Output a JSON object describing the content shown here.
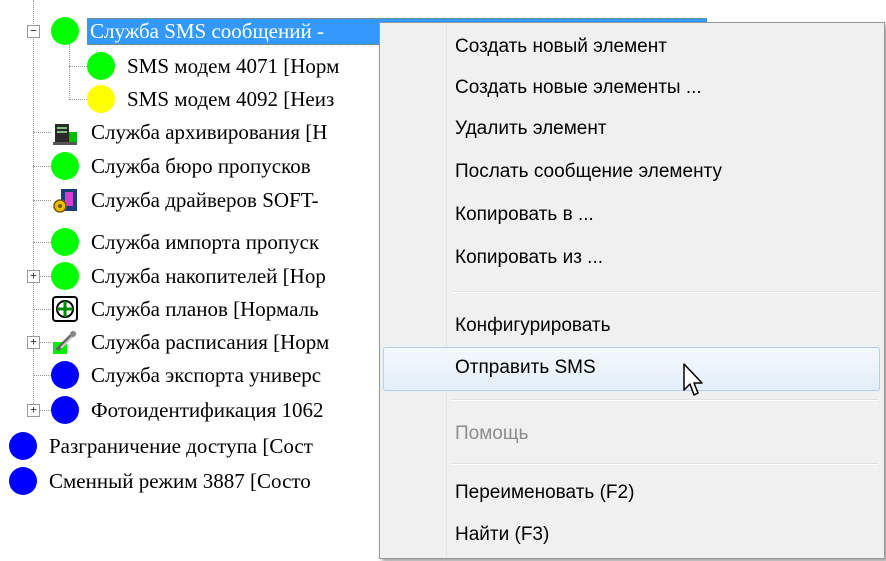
{
  "tree": {
    "items": [
      {
        "label": "Служба SMS сообщений -",
        "icon": "green-circle-icon",
        "selected": true
      },
      {
        "label": "SMS модем 4071 [Норм",
        "icon": "green-circle-icon"
      },
      {
        "label": "SMS модем 4092 [Неиз",
        "icon": "yellow-circle-icon"
      },
      {
        "label": "Служба архивирования [Н",
        "icon": "archive-service-icon"
      },
      {
        "label": "Служба бюро пропусков",
        "icon": "green-circle-icon"
      },
      {
        "label": "Служба драйверов SOFT-",
        "icon": "driver-service-icon"
      },
      {
        "label": "Служба импорта пропуск",
        "icon": "green-circle-icon"
      },
      {
        "label": "Служба накопителей [Нор",
        "icon": "green-circle-icon"
      },
      {
        "label": "Служба планов [Нормаль",
        "icon": "plan-service-icon"
      },
      {
        "label": "Служба расписания [Норм",
        "icon": "schedule-service-icon"
      },
      {
        "label": "Служба экспорта универс",
        "icon": "blue-circle-icon"
      },
      {
        "label": "Фотоидентификация 1062",
        "icon": "blue-circle-icon"
      },
      {
        "label": "Разграничение доступа [Сост",
        "icon": "blue-circle-icon"
      },
      {
        "label": "Сменный режим 3887 [Состо",
        "icon": "blue-circle-icon"
      }
    ]
  },
  "context_menu": {
    "items": [
      {
        "label": "Создать новый элемент"
      },
      {
        "label": "Создать новые элементы ..."
      },
      {
        "label": "Удалить элемент"
      },
      {
        "label": "Послать сообщение элементу"
      },
      {
        "label": "Копировать в ..."
      },
      {
        "label": "Копировать из ..."
      },
      {
        "label": "Конфигурировать"
      },
      {
        "label": "Отправить SMS",
        "state": "hover"
      },
      {
        "label": "Помощь",
        "state": "disabled"
      },
      {
        "label": "Переименовать (F2)"
      },
      {
        "label": "Найти (F3)"
      }
    ]
  },
  "colors": {
    "selection": "#3399ff",
    "menu_background": "#f0f0f0",
    "status_green": "#00ff00",
    "status_yellow": "#ffff00",
    "status_blue": "#0000ff"
  }
}
